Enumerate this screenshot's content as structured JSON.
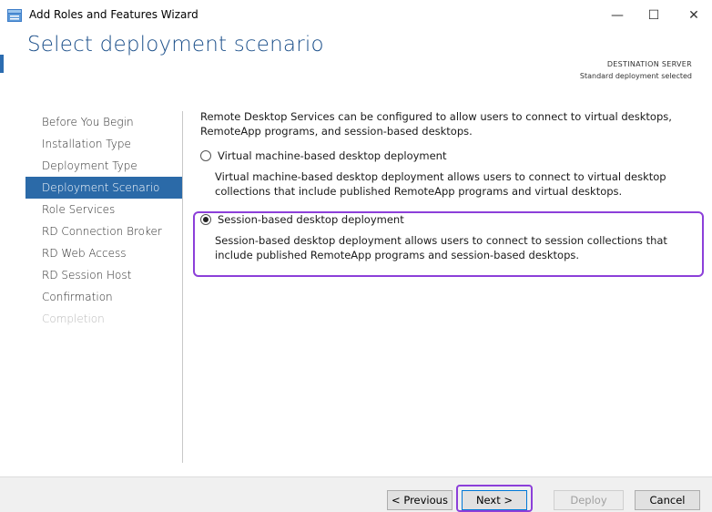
{
  "window": {
    "title": "Add Roles and Features Wizard",
    "minimize": "—",
    "maximize": "☐",
    "close": "✕"
  },
  "header": {
    "title": "Select deployment scenario",
    "destination_label": "DESTINATION SERVER",
    "destination_value": "Standard deployment selected"
  },
  "sidebar": {
    "items": [
      {
        "label": "Before You Begin",
        "state": "normal"
      },
      {
        "label": "Installation Type",
        "state": "normal"
      },
      {
        "label": "Deployment Type",
        "state": "normal"
      },
      {
        "label": "Deployment Scenario",
        "state": "active"
      },
      {
        "label": "Role Services",
        "state": "normal"
      },
      {
        "label": "RD Connection Broker",
        "state": "normal"
      },
      {
        "label": "RD Web Access",
        "state": "normal"
      },
      {
        "label": "RD Session Host",
        "state": "normal"
      },
      {
        "label": "Confirmation",
        "state": "normal"
      },
      {
        "label": "Completion",
        "state": "disabled"
      }
    ]
  },
  "content": {
    "intro": "Remote Desktop Services can be configured to allow users to connect to virtual desktops, RemoteApp programs, and session-based desktops.",
    "options": [
      {
        "label": "Virtual machine-based desktop deployment",
        "description": "Virtual machine-based desktop deployment allows users to connect to virtual desktop collections that include published RemoteApp programs and virtual desktops.",
        "checked": false
      },
      {
        "label": "Session-based desktop deployment",
        "description": "Session-based desktop deployment allows users to connect to session collections that include published RemoteApp programs and session-based desktops.",
        "checked": true
      }
    ]
  },
  "footer": {
    "previous": "< Previous",
    "next": "Next >",
    "deploy": "Deploy",
    "cancel": "Cancel"
  },
  "colors": {
    "title_blue": "#1b4f8a",
    "active_nav": "#2b6aa8",
    "highlight": "#8c3fd9"
  }
}
